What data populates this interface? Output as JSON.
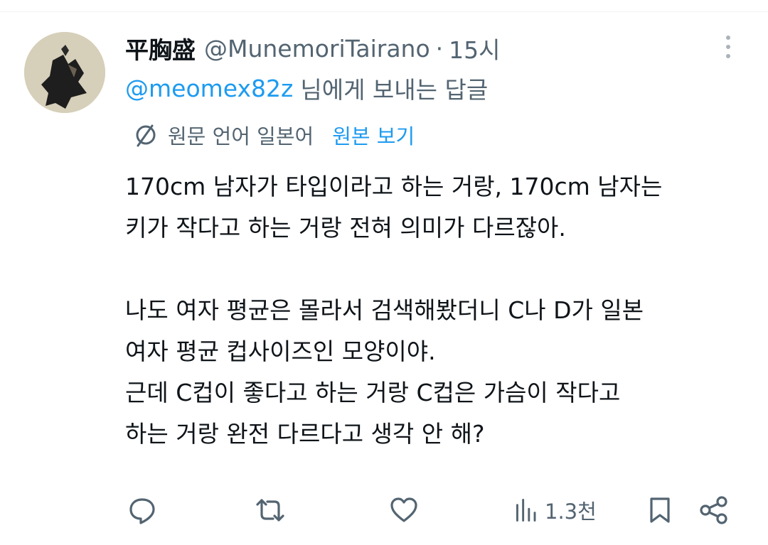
{
  "tweet": {
    "display_name": "平胸盛",
    "handle": "@MunemoriTairano",
    "separator": "·",
    "time": "15시",
    "reply_mention": "@meomex82z",
    "reply_suffix": "님에게 보내는 답글",
    "translation_note": "원문 언어 일본어",
    "show_original_label": "원본 보기",
    "body_lines": [
      "170cm 남자가 타입이라고 하는 거랑, 170cm 남자는",
      "키가 작다고 하는 거랑 전혀 의미가 다르잖아.",
      "",
      "나도 여자 평균은 몰라서 검색해봤더니 C나 D가 일본",
      "여자 평균 컵사이즈인 모양이야.",
      "근데 C컵이 좋다고 하는 거랑 C컵은 가슴이 작다고",
      "하는 거랑 완전 다르다고 생각 안 해?"
    ],
    "views": "1.3천"
  },
  "icons": {
    "more": "more-vertical-icon",
    "translate": "globe-slash-icon",
    "reply": "reply-bubble-icon",
    "retweet": "retweet-icon",
    "like": "heart-icon",
    "views": "bar-chart-icon",
    "bookmark": "bookmark-icon",
    "share": "share-icon"
  },
  "colors": {
    "accent": "#1d9bf0",
    "secondary_text": "#536471",
    "primary_text": "#0f1419",
    "icon": "#536471"
  }
}
